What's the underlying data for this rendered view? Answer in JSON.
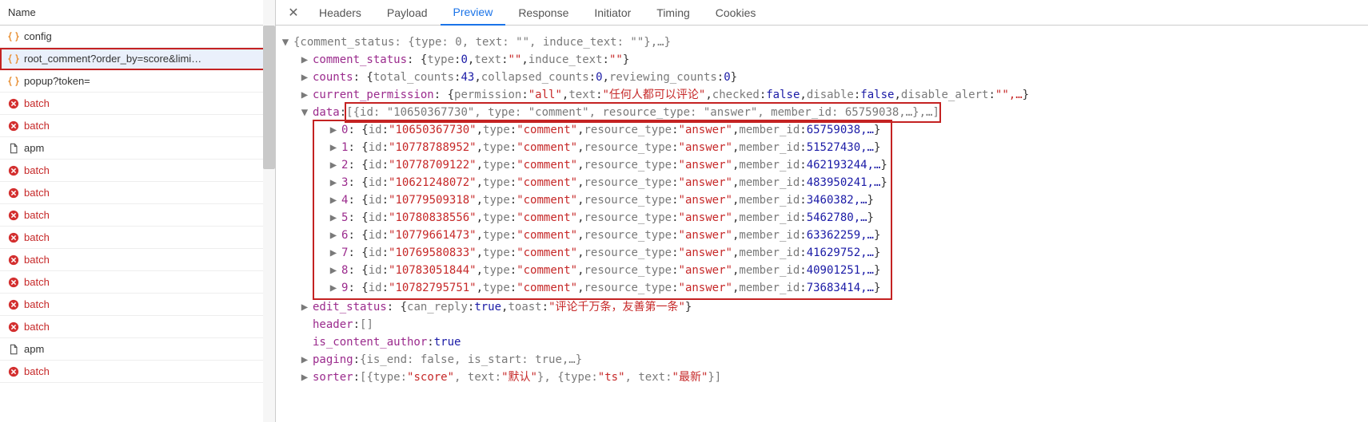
{
  "left_header": "Name",
  "requests": [
    {
      "icon": "json",
      "state": "",
      "label": "config",
      "selected": false
    },
    {
      "icon": "json",
      "state": "",
      "label": "root_comment?order_by=score&limi…",
      "selected": true
    },
    {
      "icon": "json",
      "state": "",
      "label": "popup?token=",
      "selected": false
    },
    {
      "icon": "error",
      "state": "",
      "label": "batch",
      "selected": false
    },
    {
      "icon": "error",
      "state": "",
      "label": "batch",
      "selected": false
    },
    {
      "icon": "doc",
      "state": "",
      "label": "apm",
      "selected": false
    },
    {
      "icon": "error",
      "state": "",
      "label": "batch",
      "selected": false
    },
    {
      "icon": "error",
      "state": "",
      "label": "batch",
      "selected": false
    },
    {
      "icon": "error",
      "state": "",
      "label": "batch",
      "selected": false
    },
    {
      "icon": "error",
      "state": "",
      "label": "batch",
      "selected": false
    },
    {
      "icon": "error",
      "state": "",
      "label": "batch",
      "selected": false
    },
    {
      "icon": "error",
      "state": "",
      "label": "batch",
      "selected": false
    },
    {
      "icon": "error",
      "state": "",
      "label": "batch",
      "selected": false
    },
    {
      "icon": "error",
      "state": "",
      "label": "batch",
      "selected": false
    },
    {
      "icon": "doc",
      "state": "",
      "label": "apm",
      "selected": false
    },
    {
      "icon": "error",
      "state": "",
      "label": "batch",
      "selected": false
    }
  ],
  "tabs": [
    "Headers",
    "Payload",
    "Preview",
    "Response",
    "Initiator",
    "Timing",
    "Cookies"
  ],
  "active_tab": "Preview",
  "tree": {
    "root_preview": "{comment_status: {type: 0, text: \"\", induce_text: \"\"},…}",
    "comment_status": {
      "type": 0,
      "text": "\"\"",
      "induce_text": "\"\""
    },
    "counts": {
      "total_counts": 43,
      "collapsed_counts": 0,
      "reviewing_counts": 0
    },
    "current_permission": {
      "permission": "\"all\"",
      "text": "\"任何人都可以评论\"",
      "checked": "false",
      "disable": "false",
      "disable_alert": "\"\",…"
    },
    "data_header_suffix": "[{id: \"10650367730\", type: \"comment\", resource_type: \"answer\", member_id: 65759038,…},…]",
    "items": [
      {
        "idx": "0",
        "id": "\"10650367730\"",
        "type": "\"comment\"",
        "resource_type": "\"answer\"",
        "member_id": "65759038,…"
      },
      {
        "idx": "1",
        "id": "\"10778788952\"",
        "type": "\"comment\"",
        "resource_type": "\"answer\"",
        "member_id": "51527430,…"
      },
      {
        "idx": "2",
        "id": "\"10778709122\"",
        "type": "\"comment\"",
        "resource_type": "\"answer\"",
        "member_id": "462193244,…"
      },
      {
        "idx": "3",
        "id": "\"10621248072\"",
        "type": "\"comment\"",
        "resource_type": "\"answer\"",
        "member_id": "483950241,…"
      },
      {
        "idx": "4",
        "id": "\"10779509318\"",
        "type": "\"comment\"",
        "resource_type": "\"answer\"",
        "member_id": "3460382,…"
      },
      {
        "idx": "5",
        "id": "\"10780838556\"",
        "type": "\"comment\"",
        "resource_type": "\"answer\"",
        "member_id": "5462780,…"
      },
      {
        "idx": "6",
        "id": "\"10779661473\"",
        "type": "\"comment\"",
        "resource_type": "\"answer\"",
        "member_id": "63362259,…"
      },
      {
        "idx": "7",
        "id": "\"10769580833\"",
        "type": "\"comment\"",
        "resource_type": "\"answer\"",
        "member_id": "41629752,…"
      },
      {
        "idx": "8",
        "id": "\"10783051844\"",
        "type": "\"comment\"",
        "resource_type": "\"answer\"",
        "member_id": "40901251,…"
      },
      {
        "idx": "9",
        "id": "\"10782795751\"",
        "type": "\"comment\"",
        "resource_type": "\"answer\"",
        "member_id": "73683414,…"
      }
    ],
    "edit_status": {
      "can_reply": "true",
      "toast": "\"评论千万条，友善第一条\""
    },
    "header_val": "[]",
    "is_content_author": "true",
    "paging": "{is_end: false, is_start: true,…}",
    "sorter": "[{type: \"score\", text: \"默认\"}, {type: \"ts\", text: \"最新\"}]"
  },
  "labels": {
    "comment_status": "comment_status",
    "counts": "counts",
    "current_permission": "current_permission",
    "data": "data",
    "edit_status": "edit_status",
    "header": "header",
    "is_content_author": "is_content_author",
    "paging": "paging",
    "sorter": "sorter",
    "type": "type",
    "text": "text",
    "induce_text": "induce_text",
    "total_counts": "total_counts",
    "collapsed_counts": "collapsed_counts",
    "reviewing_counts": "reviewing_counts",
    "permission": "permission",
    "checked": "checked",
    "disable": "disable",
    "disable_alert": "disable_alert",
    "id": "id",
    "resource_type": "resource_type",
    "member_id": "member_id",
    "can_reply": "can_reply",
    "toast": "toast"
  }
}
